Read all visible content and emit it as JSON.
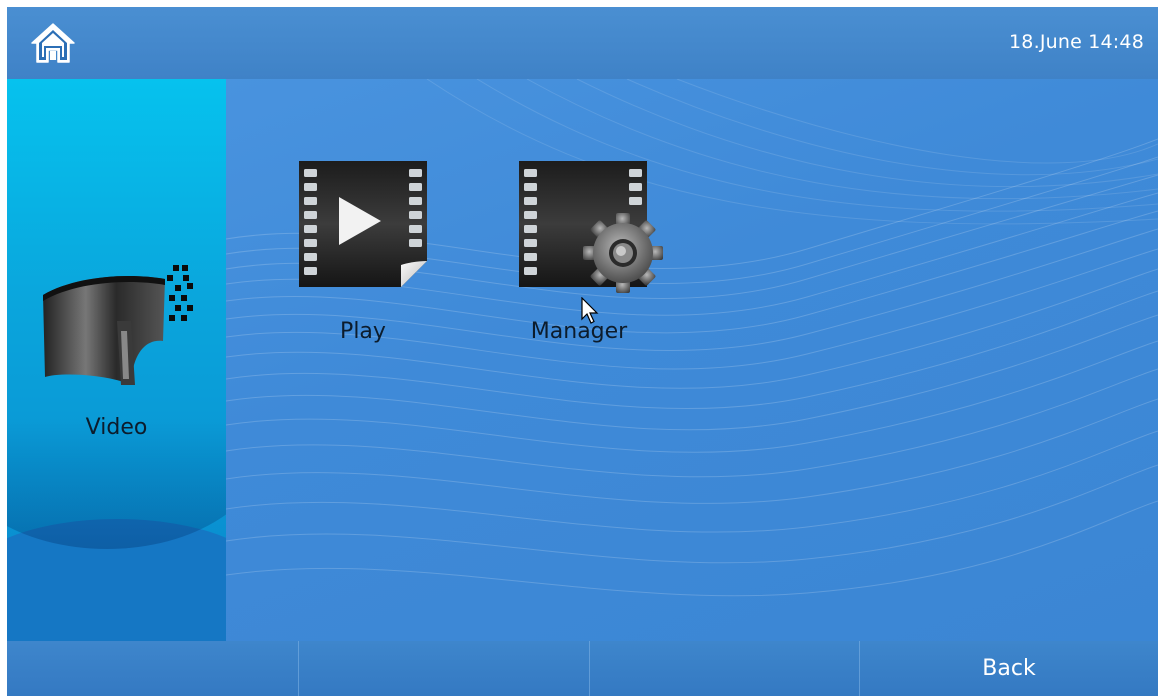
{
  "header": {
    "home_icon": "home-icon",
    "datetime": "18.June 14:48"
  },
  "sidebar": {
    "icon": "film-reel-icon",
    "label": "Video"
  },
  "apps": [
    {
      "label": "Play",
      "icon": "film-play-icon"
    },
    {
      "label": "Manager",
      "icon": "film-gear-icon"
    }
  ],
  "footer": {
    "back_label": "Back"
  },
  "colors": {
    "background": "#3e8ad8",
    "sidebar": "#0aa5dc",
    "text_dark": "#0c1c2c",
    "text_light": "#ffffff"
  }
}
